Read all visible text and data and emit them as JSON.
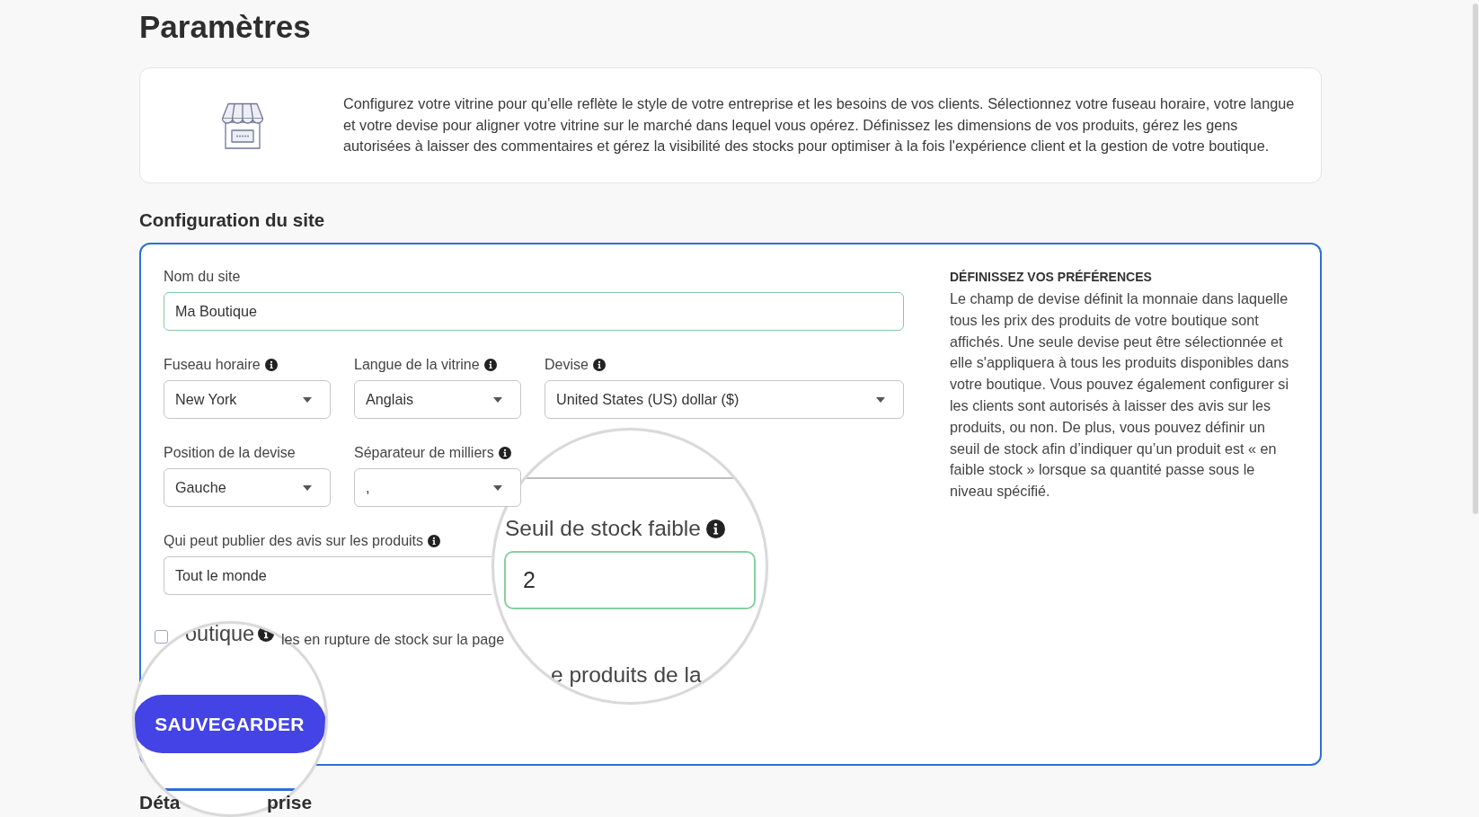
{
  "title": "Paramètres",
  "intro": {
    "text": "Configurez votre vitrine pour qu'elle reflète le style de votre entreprise et les besoins de vos clients. Sélectionnez votre fuseau horaire, votre langue et votre devise pour aligner votre vitrine sur le marché dans lequel vous opérez. Définissez les dimensions de vos produits, gérez les gens autorisées à laisser des commentaires et gérez la visibilité des stocks pour optimiser à la fois l'expérience client et la gestion de votre boutique."
  },
  "section_title": "Configuration du site",
  "site_config": {
    "rows": [
      [
        {
          "kind": "text",
          "label": "Nom du site",
          "info": false,
          "value": "Ma Boutique",
          "valid": true
        }
      ],
      [
        {
          "kind": "select",
          "label": "Fuseau horaire",
          "info": true,
          "value": "New York"
        },
        {
          "kind": "select",
          "label": "Langue de la vitrine",
          "info": true,
          "value": "Anglais"
        },
        {
          "kind": "select",
          "label": "Devise",
          "info": true,
          "value": "United States (US) dollar ($)"
        }
      ],
      [
        {
          "kind": "select",
          "label": "Position de la devise",
          "info": false,
          "value": "Gauche"
        },
        {
          "kind": "select",
          "label": "Séparateur de milliers",
          "info": true,
          "value": ","
        }
      ],
      [
        {
          "kind": "text",
          "label": "Qui peut publier des avis sur les produits",
          "info": true,
          "value": "Tout le monde",
          "valid": false
        }
      ]
    ],
    "checkbox": {
      "checked": false,
      "label": "les en rupture de stock sur la page"
    },
    "help": {
      "title": "DÉFINISSEZ VOS PRÉFÉRENCES",
      "text": "Le champ de devise définit la monnaie dans laquelle tous les prix des produits de votre boutique sont affichés. Une seule devise peut être sélectionnée et elle s'appliquera à tous les produits disponibles dans votre boutique. Vous pouvez également configurer si les clients sont autorisés à laisser des avis sur les produits, ou non. De plus, vous pouvez définir un seuil de stock afin d’indiquer qu’un produit est « en faible stock » lorsque sa quantité passe sous le niveau spécifié."
    }
  },
  "magnifiers": [
    {
      "kind": "field",
      "label": "Seuil de stock faible",
      "info": true,
      "value": "2",
      "valid": true,
      "text_below": "e produits de la"
    },
    {
      "kind": "button",
      "text_above": "outique",
      "info": true,
      "button": "SAUVEGARDER"
    }
  ],
  "next_section_title": [
    "Déta",
    "prise"
  ]
}
